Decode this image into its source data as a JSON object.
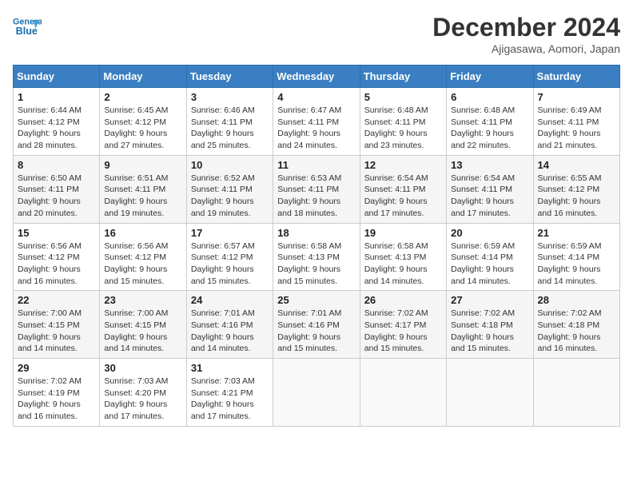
{
  "header": {
    "logo_line1": "General",
    "logo_line2": "Blue",
    "month": "December 2024",
    "location": "Ajigasawa, Aomori, Japan"
  },
  "days_of_week": [
    "Sunday",
    "Monday",
    "Tuesday",
    "Wednesday",
    "Thursday",
    "Friday",
    "Saturday"
  ],
  "weeks": [
    [
      {
        "day": "1",
        "info": "Sunrise: 6:44 AM\nSunset: 4:12 PM\nDaylight: 9 hours\nand 28 minutes."
      },
      {
        "day": "2",
        "info": "Sunrise: 6:45 AM\nSunset: 4:12 PM\nDaylight: 9 hours\nand 27 minutes."
      },
      {
        "day": "3",
        "info": "Sunrise: 6:46 AM\nSunset: 4:11 PM\nDaylight: 9 hours\nand 25 minutes."
      },
      {
        "day": "4",
        "info": "Sunrise: 6:47 AM\nSunset: 4:11 PM\nDaylight: 9 hours\nand 24 minutes."
      },
      {
        "day": "5",
        "info": "Sunrise: 6:48 AM\nSunset: 4:11 PM\nDaylight: 9 hours\nand 23 minutes."
      },
      {
        "day": "6",
        "info": "Sunrise: 6:48 AM\nSunset: 4:11 PM\nDaylight: 9 hours\nand 22 minutes."
      },
      {
        "day": "7",
        "info": "Sunrise: 6:49 AM\nSunset: 4:11 PM\nDaylight: 9 hours\nand 21 minutes."
      }
    ],
    [
      {
        "day": "8",
        "info": "Sunrise: 6:50 AM\nSunset: 4:11 PM\nDaylight: 9 hours\nand 20 minutes."
      },
      {
        "day": "9",
        "info": "Sunrise: 6:51 AM\nSunset: 4:11 PM\nDaylight: 9 hours\nand 19 minutes."
      },
      {
        "day": "10",
        "info": "Sunrise: 6:52 AM\nSunset: 4:11 PM\nDaylight: 9 hours\nand 19 minutes."
      },
      {
        "day": "11",
        "info": "Sunrise: 6:53 AM\nSunset: 4:11 PM\nDaylight: 9 hours\nand 18 minutes."
      },
      {
        "day": "12",
        "info": "Sunrise: 6:54 AM\nSunset: 4:11 PM\nDaylight: 9 hours\nand 17 minutes."
      },
      {
        "day": "13",
        "info": "Sunrise: 6:54 AM\nSunset: 4:11 PM\nDaylight: 9 hours\nand 17 minutes."
      },
      {
        "day": "14",
        "info": "Sunrise: 6:55 AM\nSunset: 4:12 PM\nDaylight: 9 hours\nand 16 minutes."
      }
    ],
    [
      {
        "day": "15",
        "info": "Sunrise: 6:56 AM\nSunset: 4:12 PM\nDaylight: 9 hours\nand 16 minutes."
      },
      {
        "day": "16",
        "info": "Sunrise: 6:56 AM\nSunset: 4:12 PM\nDaylight: 9 hours\nand 15 minutes."
      },
      {
        "day": "17",
        "info": "Sunrise: 6:57 AM\nSunset: 4:12 PM\nDaylight: 9 hours\nand 15 minutes."
      },
      {
        "day": "18",
        "info": "Sunrise: 6:58 AM\nSunset: 4:13 PM\nDaylight: 9 hours\nand 15 minutes."
      },
      {
        "day": "19",
        "info": "Sunrise: 6:58 AM\nSunset: 4:13 PM\nDaylight: 9 hours\nand 14 minutes."
      },
      {
        "day": "20",
        "info": "Sunrise: 6:59 AM\nSunset: 4:14 PM\nDaylight: 9 hours\nand 14 minutes."
      },
      {
        "day": "21",
        "info": "Sunrise: 6:59 AM\nSunset: 4:14 PM\nDaylight: 9 hours\nand 14 minutes."
      }
    ],
    [
      {
        "day": "22",
        "info": "Sunrise: 7:00 AM\nSunset: 4:15 PM\nDaylight: 9 hours\nand 14 minutes."
      },
      {
        "day": "23",
        "info": "Sunrise: 7:00 AM\nSunset: 4:15 PM\nDaylight: 9 hours\nand 14 minutes."
      },
      {
        "day": "24",
        "info": "Sunrise: 7:01 AM\nSunset: 4:16 PM\nDaylight: 9 hours\nand 14 minutes."
      },
      {
        "day": "25",
        "info": "Sunrise: 7:01 AM\nSunset: 4:16 PM\nDaylight: 9 hours\nand 15 minutes."
      },
      {
        "day": "26",
        "info": "Sunrise: 7:02 AM\nSunset: 4:17 PM\nDaylight: 9 hours\nand 15 minutes."
      },
      {
        "day": "27",
        "info": "Sunrise: 7:02 AM\nSunset: 4:18 PM\nDaylight: 9 hours\nand 15 minutes."
      },
      {
        "day": "28",
        "info": "Sunrise: 7:02 AM\nSunset: 4:18 PM\nDaylight: 9 hours\nand 16 minutes."
      }
    ],
    [
      {
        "day": "29",
        "info": "Sunrise: 7:02 AM\nSunset: 4:19 PM\nDaylight: 9 hours\nand 16 minutes."
      },
      {
        "day": "30",
        "info": "Sunrise: 7:03 AM\nSunset: 4:20 PM\nDaylight: 9 hours\nand 17 minutes."
      },
      {
        "day": "31",
        "info": "Sunrise: 7:03 AM\nSunset: 4:21 PM\nDaylight: 9 hours\nand 17 minutes."
      },
      {
        "day": "",
        "info": ""
      },
      {
        "day": "",
        "info": ""
      },
      {
        "day": "",
        "info": ""
      },
      {
        "day": "",
        "info": ""
      }
    ]
  ]
}
